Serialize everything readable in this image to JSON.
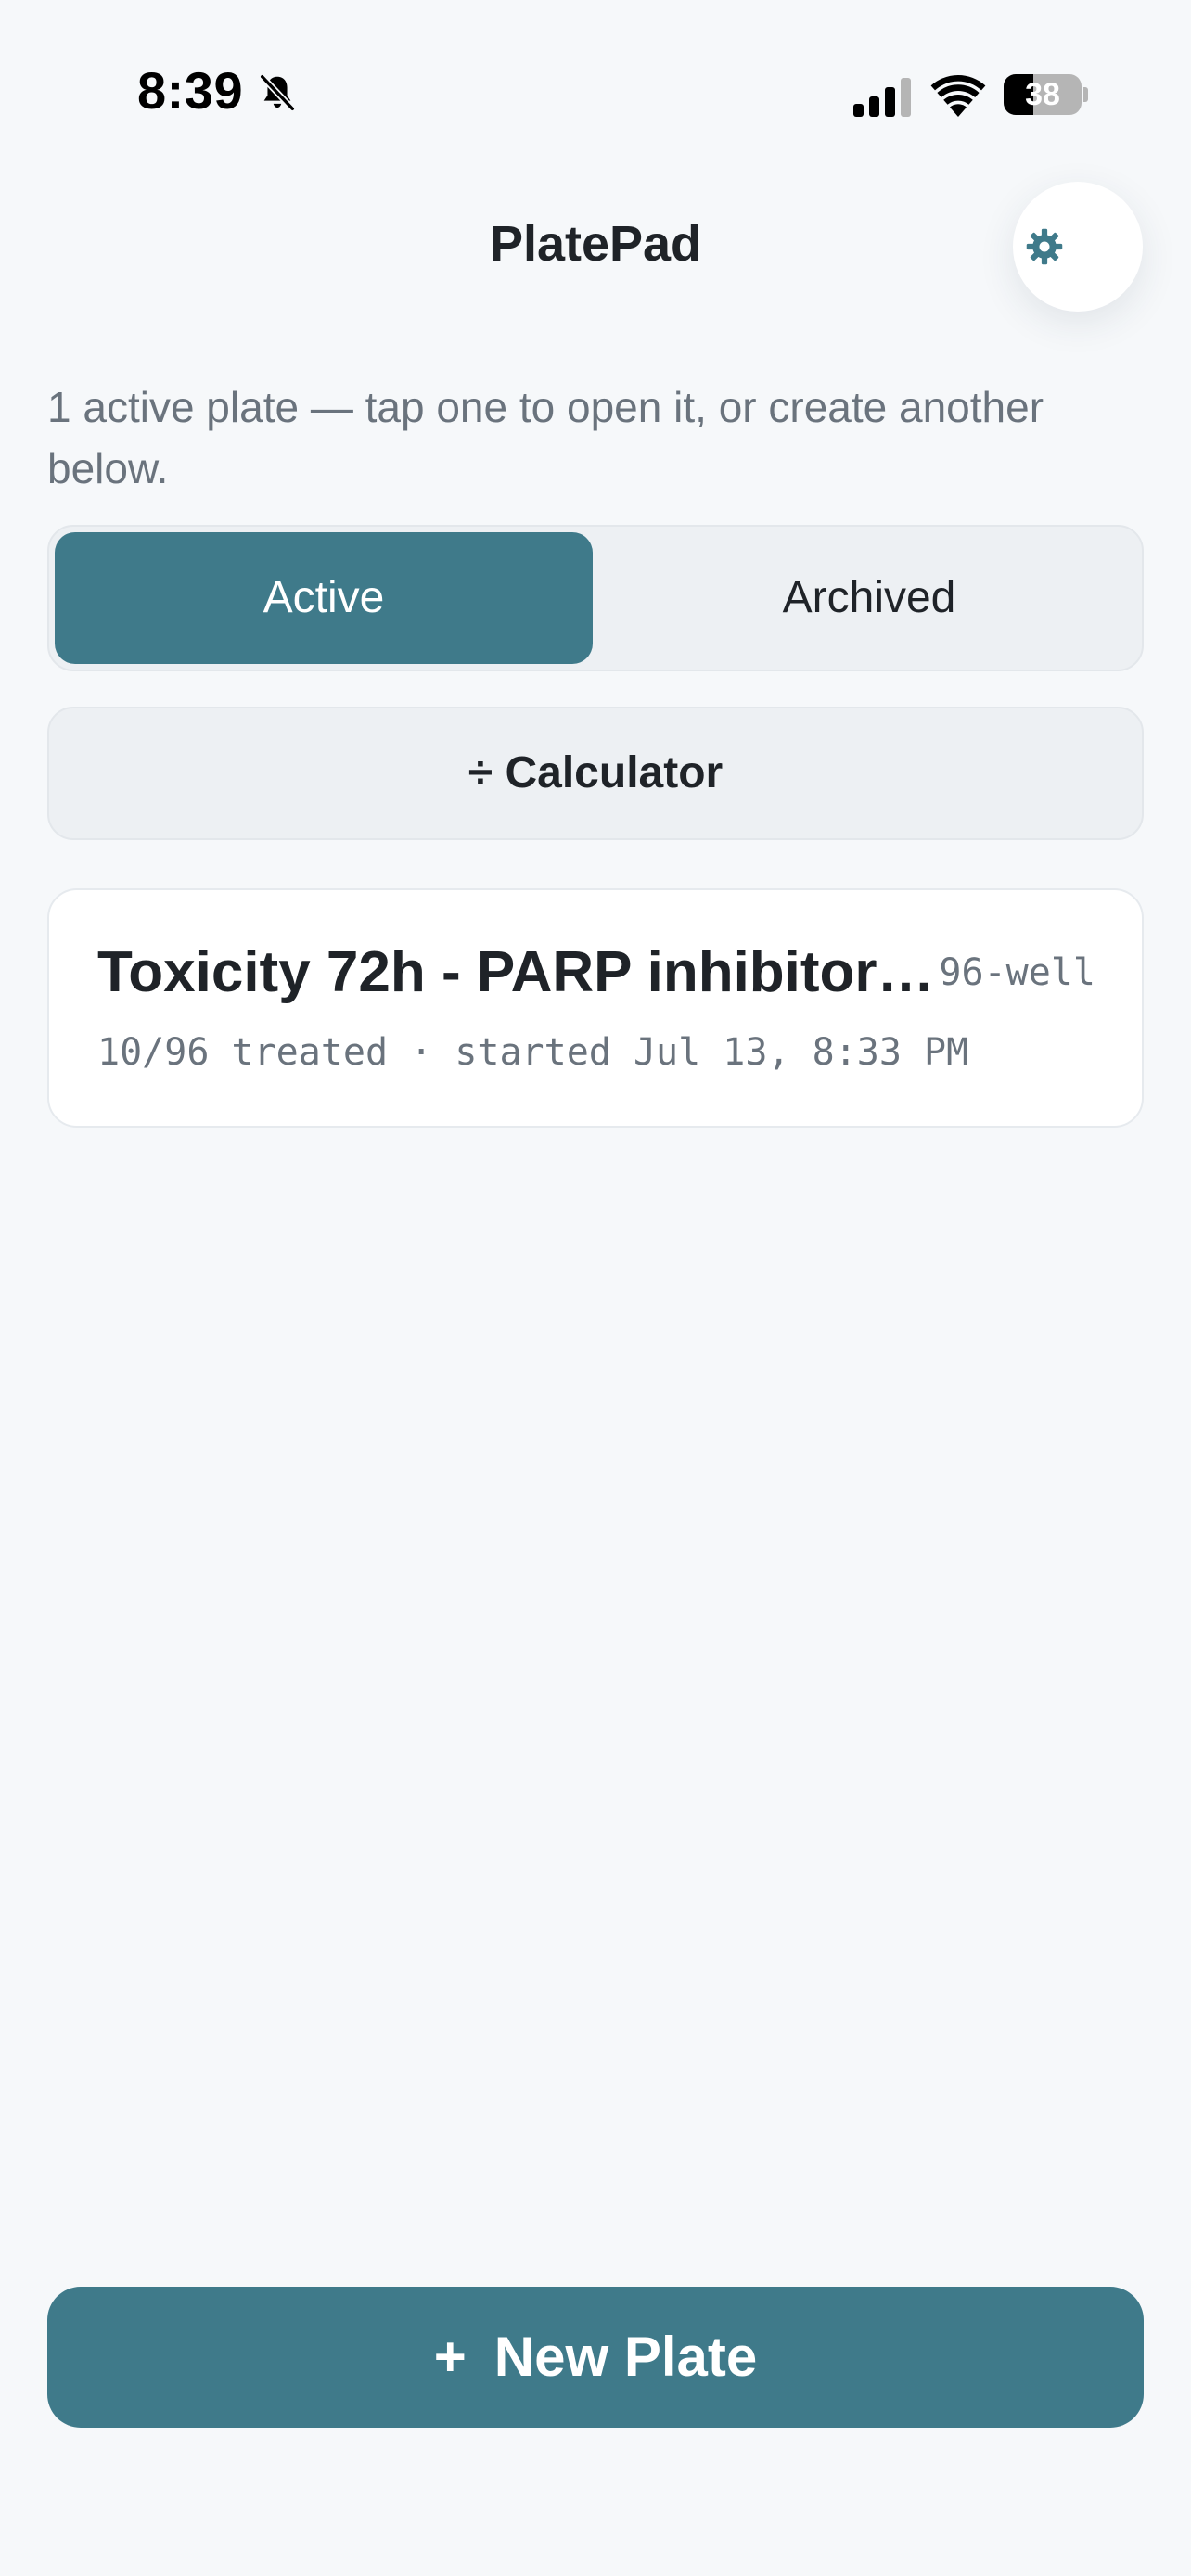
{
  "status_bar": {
    "time": "8:39",
    "battery_level": 38,
    "battery_text": "38",
    "icons": [
      "bell-slash-icon",
      "cellular-signal-icon",
      "wifi-icon",
      "battery-icon"
    ]
  },
  "header": {
    "title": "PlatePad",
    "settings_icon": "gear-icon"
  },
  "intro": {
    "text": "1 active plate — tap one to open it, or create another below."
  },
  "segmented_control": {
    "selected": "Active",
    "options": [
      {
        "label": "Active"
      },
      {
        "label": "Archived"
      }
    ]
  },
  "calculator": {
    "label": "÷ Calculator"
  },
  "plates": [
    {
      "name": "Toxicity 72h - PARP inhibitor…",
      "format": "96-well",
      "meta": "10/96 treated · started Jul 13, 8:33 PM"
    }
  ],
  "new_plate": {
    "icon": "+",
    "label": "New Plate"
  },
  "colors": {
    "accent": "#3f7a8a",
    "background": "#f6f8fa",
    "muted_text": "#6a737d",
    "primary_text": "#1f2328"
  }
}
